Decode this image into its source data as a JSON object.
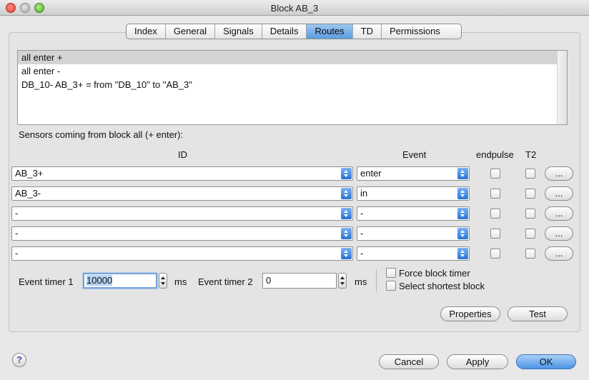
{
  "window": {
    "title": "Block AB_3"
  },
  "tabs": [
    "Index",
    "General",
    "Signals",
    "Details",
    "Routes",
    "TD",
    "Permissions"
  ],
  "active_tab": "Routes",
  "routes": [
    "all enter +",
    "all enter -",
    "DB_10- AB_3+ = from \"DB_10\" to \"AB_3\""
  ],
  "sensors": {
    "label": "Sensors coming from block all (+ enter):",
    "headers": {
      "id": "ID",
      "event": "Event",
      "endpulse": "endpulse",
      "t2": "T2"
    },
    "rows": [
      {
        "id": "AB_3+",
        "event": "enter",
        "endpulse": false,
        "t2": false,
        "button": "..."
      },
      {
        "id": "AB_3-",
        "event": "in",
        "endpulse": false,
        "t2": false,
        "button": "..."
      },
      {
        "id": "-",
        "event": "-",
        "endpulse": false,
        "t2": false,
        "button": "..."
      },
      {
        "id": "-",
        "event": "-",
        "endpulse": false,
        "t2": false,
        "button": "..."
      },
      {
        "id": "-",
        "event": "-",
        "endpulse": false,
        "t2": false,
        "button": "..."
      }
    ]
  },
  "timers": {
    "timer1_label": "Event timer 1",
    "timer1_value": "10000",
    "timer1_unit": "ms",
    "timer2_label": "Event timer 2",
    "timer2_value": "0",
    "timer2_unit": "ms"
  },
  "options": {
    "force_block_timer": "Force block timer",
    "select_shortest_block": "Select shortest block"
  },
  "buttons": {
    "properties": "Properties",
    "test": "Test",
    "cancel": "Cancel",
    "apply": "Apply",
    "ok": "OK",
    "help": "?"
  },
  "colors": {
    "accent": "#5b9de1",
    "selection": "#d4d4d4",
    "window_bg": "#e8e8e8"
  }
}
